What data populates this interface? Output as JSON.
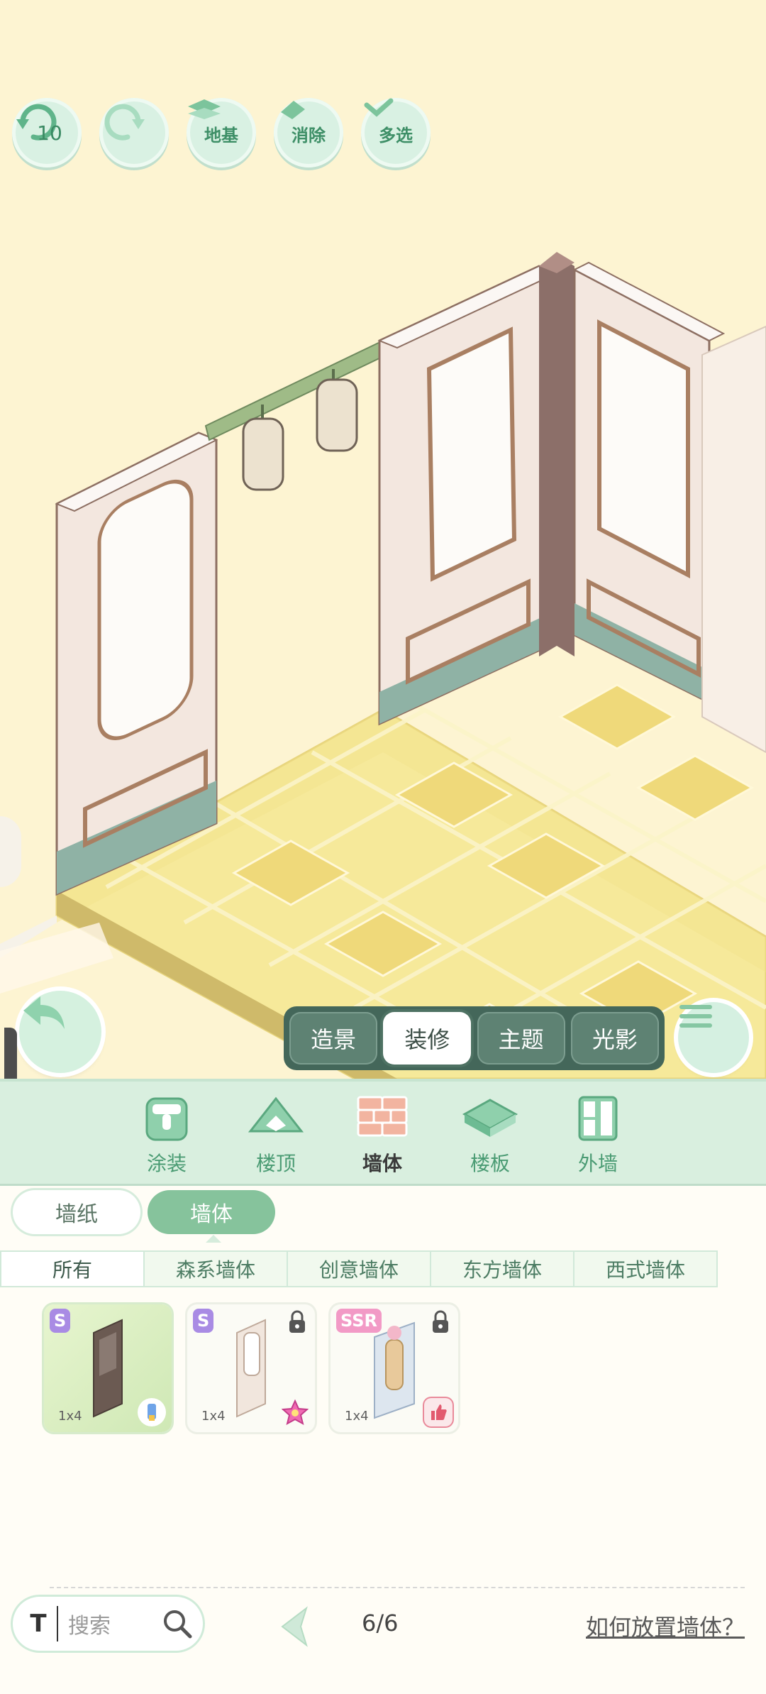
{
  "toolbar": {
    "undo_count": "10",
    "foundation_label": "地基",
    "erase_label": "消除",
    "multiselect_label": "多选"
  },
  "modes": [
    {
      "label": "造景",
      "active": false
    },
    {
      "label": "装修",
      "active": true
    },
    {
      "label": "主题",
      "active": false
    },
    {
      "label": "光影",
      "active": false
    }
  ],
  "categories": [
    {
      "label": "涂装",
      "icon": "paint-bucket-icon",
      "active": false
    },
    {
      "label": "楼顶",
      "icon": "roof-icon",
      "active": false
    },
    {
      "label": "墙体",
      "icon": "brick-wall-icon",
      "active": true
    },
    {
      "label": "楼板",
      "icon": "floor-slab-icon",
      "active": false
    },
    {
      "label": "外墙",
      "icon": "exterior-wall-icon",
      "active": false
    }
  ],
  "sub_tabs": {
    "wallpaper": "墙纸",
    "wall": "墙体",
    "active": "墙体"
  },
  "filters": [
    "所有",
    "森系墙体",
    "创意墙体",
    "东方墙体",
    "西式墙体"
  ],
  "items": [
    {
      "rarity": "S",
      "size": "1x4",
      "locked": false,
      "badge": "paint-tube-icon"
    },
    {
      "rarity": "S",
      "size": "1x4",
      "locked": true,
      "badge": "star-icon"
    },
    {
      "rarity": "SSR",
      "size": "1x4",
      "locked": true,
      "badge": "thumbs-up-icon"
    }
  ],
  "search": {
    "placeholder": "搜索"
  },
  "pagination": {
    "current": "6/6"
  },
  "help_link": "如何放置墙体？",
  "colors": {
    "accent": "#86c39c",
    "mode_bar": "#44675a",
    "scene_bg": "#fdf4d2",
    "floor": "#f6e99a"
  }
}
